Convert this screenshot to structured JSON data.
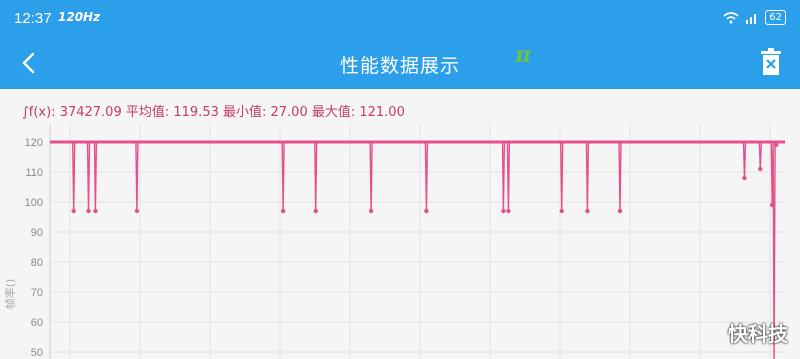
{
  "status_bar": {
    "time": "12:37",
    "refresh_rate": "120Hz",
    "battery": "62"
  },
  "app_bar": {
    "title": "性能数据展示",
    "logo_text": "π"
  },
  "stats": {
    "text": "∫f(x): 37427.09 平均值: 119.53 最小值: 27.00 最大值: 121.00"
  },
  "chart_data": {
    "type": "line",
    "ylabel": "帧率()",
    "yticks": [
      120,
      110,
      100,
      90,
      80,
      70,
      60,
      50
    ],
    "ylim": [
      46,
      126
    ],
    "color": "#e5508a",
    "x_count": 745,
    "baseline": 120,
    "dips": [
      {
        "x": 24,
        "y": 97
      },
      {
        "x": 39,
        "y": 97
      },
      {
        "x": 46,
        "y": 97
      },
      {
        "x": 88,
        "y": 97
      },
      {
        "x": 236,
        "y": 97
      },
      {
        "x": 269,
        "y": 97
      },
      {
        "x": 325,
        "y": 97
      },
      {
        "x": 381,
        "y": 97
      },
      {
        "x": 459,
        "y": 97
      },
      {
        "x": 464,
        "y": 97
      },
      {
        "x": 518,
        "y": 97
      },
      {
        "x": 544,
        "y": 97
      },
      {
        "x": 577,
        "y": 97
      },
      {
        "x": 703,
        "y": 108
      },
      {
        "x": 719,
        "y": 111
      },
      {
        "x": 731,
        "y": 99
      },
      {
        "x": 733,
        "y": 27
      },
      {
        "x": 735,
        "y": 119
      }
    ],
    "gaps": [
      175,
      437,
      538,
      572,
      606,
      707,
      722
    ]
  },
  "watermark": "快科技",
  "colors": {
    "primary": "#2c9fea",
    "series": "#e5508a",
    "stats_text": "#c8386e"
  }
}
